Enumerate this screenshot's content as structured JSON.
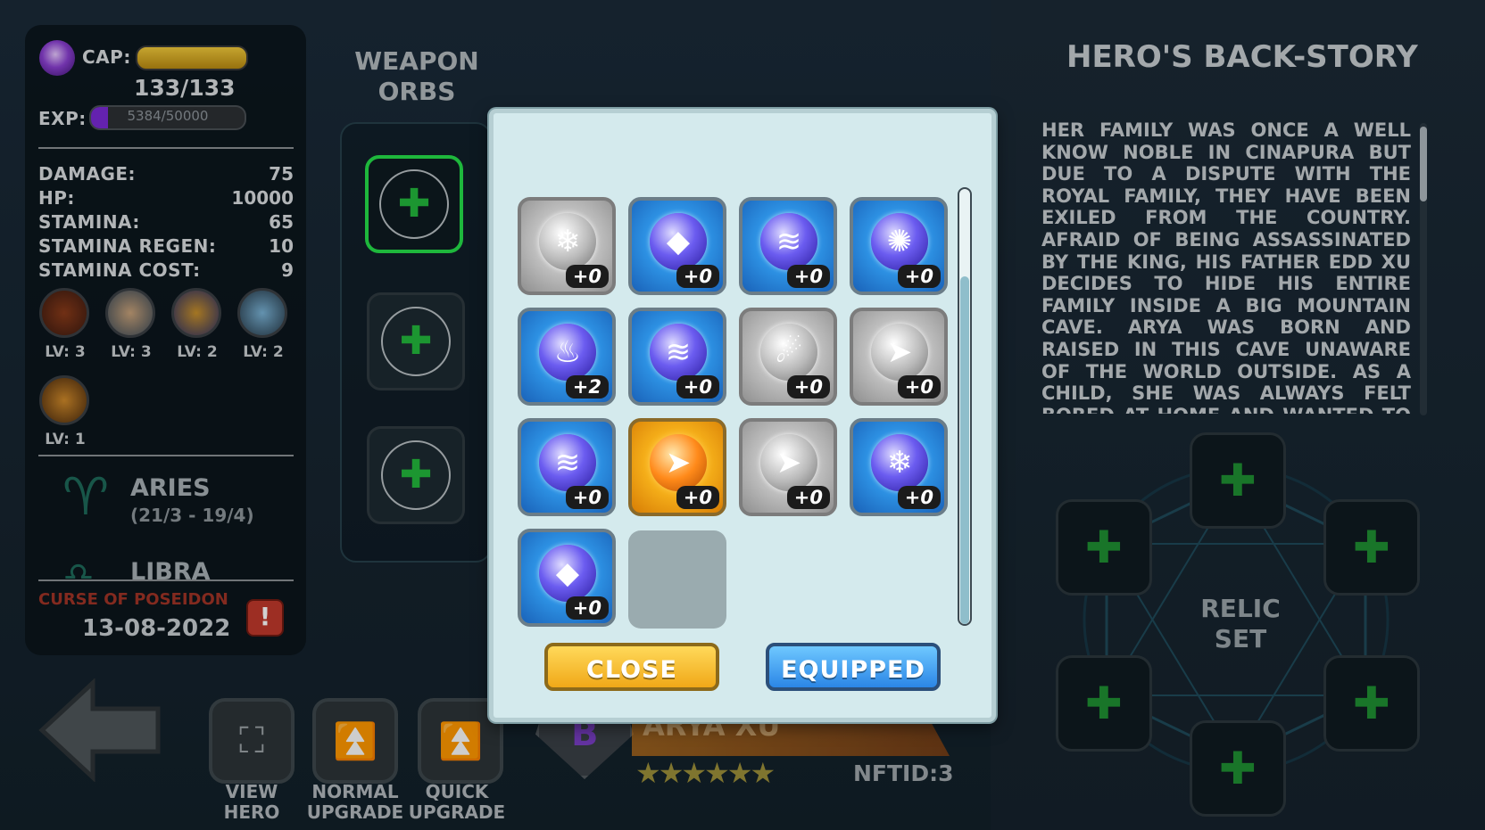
{
  "stats": {
    "cap_label": "CAP:",
    "cap_value": "133/133",
    "exp_label": "EXP:",
    "exp_value": "5384/50000",
    "exp_progress": 0.108,
    "rows": [
      {
        "label": "DAMAGE:",
        "value": "75"
      },
      {
        "label": "HP:",
        "value": "10000"
      },
      {
        "label": "STAMINA:",
        "value": "65"
      },
      {
        "label": "STAMINA REGEN:",
        "value": "10"
      },
      {
        "label": "STAMINA COST:",
        "value": "9"
      }
    ],
    "skills": [
      {
        "icon": "fire-skill-icon",
        "level": "LV: 3"
      },
      {
        "icon": "wind-skill-icon",
        "level": "LV: 3"
      },
      {
        "icon": "arcane-skill-icon",
        "level": "LV: 2"
      },
      {
        "icon": "blade-skill-icon",
        "level": "LV: 2"
      },
      {
        "icon": "shield-skill-icon",
        "level": "LV: 1"
      }
    ],
    "zodiac": [
      {
        "name": "ARIES",
        "dates": "(21/3 - 19/4)"
      },
      {
        "name": "LIBRA",
        "dates": ""
      }
    ],
    "curse_label": "CURSE OF POSEIDON",
    "curse_date": "13-08-2022"
  },
  "weapon_orbs": {
    "title_line1": "WEAPON",
    "title_line2": "ORBS"
  },
  "orb_picker": {
    "orbs": [
      {
        "color": "grey",
        "icon": "snowflake-orb-icon",
        "level": "+0"
      },
      {
        "color": "blue",
        "icon": "crystal-orb-icon",
        "level": "+0"
      },
      {
        "color": "blue",
        "icon": "wind-orb-icon",
        "level": "+0"
      },
      {
        "color": "blue",
        "icon": "starburst-orb-icon",
        "level": "+0"
      },
      {
        "color": "blue",
        "icon": "flame-orb-icon",
        "level": "+2"
      },
      {
        "color": "blue",
        "icon": "wind-orb-icon",
        "level": "+0"
      },
      {
        "color": "grey",
        "icon": "meteor-orb-icon",
        "level": "+0"
      },
      {
        "color": "grey",
        "icon": "arrow-orb-icon",
        "level": "+0"
      },
      {
        "color": "blue",
        "icon": "wind-orb-icon",
        "level": "+0"
      },
      {
        "color": "gold",
        "icon": "arrow-orb-icon",
        "level": "+0"
      },
      {
        "color": "grey",
        "icon": "arrow-orb-icon",
        "level": "+0"
      },
      {
        "color": "blue",
        "icon": "snowflake-orb-icon",
        "level": "+0"
      },
      {
        "color": "blue",
        "icon": "crystal-orb-icon",
        "level": "+0"
      }
    ],
    "close_label": "CLOSE",
    "equipped_label": "EQUIPPED"
  },
  "hero": {
    "name": "ARYA XU",
    "rank": "B",
    "nft_id": "NFTID:3",
    "stars": 6
  },
  "back_story": {
    "title": "HERO'S BACK-STORY",
    "text": "HER FAMILY WAS ONCE A WELL KNOW NOBLE IN CINAPURA BUT DUE TO A DISPUTE WITH THE ROYAL FAMILY, THEY HAVE BEEN EXILED FROM THE COUNTRY. AFRAID OF BEING ASSASSINATED BY THE KING, HIS FATHER EDD XU DECIDES TO HIDE HIS ENTIRE FAMILY INSIDE A BIG MOUNTAIN CAVE. ARYA WAS BORN AND RAISED IN THIS CAVE UNAWARE OF THE WORLD OUTSIDE. AS A CHILD, SHE WAS ALWAYS FELT BORED AT HOME AND WANTED TO GO OUT TO DISCOVER"
  },
  "relic": {
    "label_line1": "RELIC",
    "label_line2": "SET"
  },
  "controls": {
    "view_line1": "VIEW",
    "view_line2": "HERO",
    "normal_line1": "NORMAL",
    "normal_line2": "UPGRADE",
    "quick_line1": "QUICK",
    "quick_line2": "UPGRADE"
  },
  "colors": {
    "accent_green": "#25e04a",
    "cap_bar": "#e0b326",
    "exp_bar": "#7a2ad6",
    "curse_red": "#c0392b"
  }
}
